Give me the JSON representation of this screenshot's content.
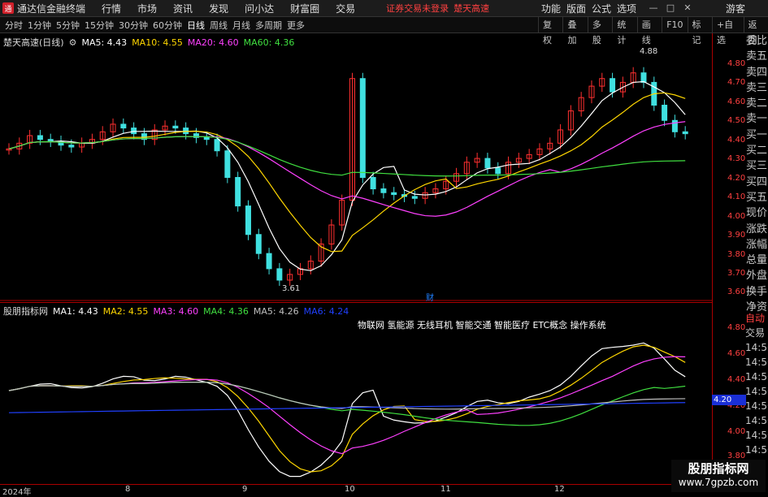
{
  "app": {
    "logo": "通",
    "name": "通达信金融终端",
    "menu": [
      "行情",
      "市场",
      "资讯",
      "发现",
      "问小达",
      "财富圈",
      "交易"
    ],
    "notice1": "证券交易未登录",
    "notice2": "楚天高速",
    "right_menu": [
      "功能",
      "版面",
      "公式",
      "选项"
    ],
    "guest": "游客",
    "win_buttons": [
      "—",
      "□",
      "✕"
    ]
  },
  "toolbar": {
    "items": [
      "分时",
      "1分钟",
      "5分钟",
      "15分钟",
      "30分钟",
      "60分钟",
      "日线",
      "周线",
      "月线",
      "多周期",
      "更多"
    ],
    "active": "日线",
    "right": [
      "复权",
      "叠加",
      "多股",
      "统计",
      "画线",
      "F10",
      "标记",
      "+自选",
      "返回"
    ]
  },
  "main": {
    "stock_label": "楚天高速(日线)",
    "ma": [
      {
        "k": "MA5: 4.43",
        "c": "#ffffff"
      },
      {
        "k": "MA10: 4.55",
        "c": "#ffd700"
      },
      {
        "k": "MA20: 4.60",
        "c": "#ff40ff"
      },
      {
        "k": "MA60: 4.36",
        "c": "#40e040"
      }
    ],
    "high": "4.88",
    "low": "3.61",
    "cai": "财"
  },
  "price_axis": [
    "4.80",
    "4.70",
    "4.60",
    "4.50",
    "4.40",
    "4.30",
    "4.20",
    "4.10",
    "4.00",
    "3.90",
    "3.80",
    "3.70",
    "3.60"
  ],
  "ind_axis": [
    "4.80",
    "4.60",
    "4.40",
    "4.20",
    "4.00",
    "3.80"
  ],
  "right_labels": [
    "委比",
    "卖五",
    "卖四",
    "卖三",
    "卖二",
    "卖一",
    "买一",
    "买二",
    "买三",
    "买四",
    "买五",
    "现价",
    "涨跌",
    "涨幅",
    "总量",
    "外盘",
    "换手",
    "净资",
    "收益"
  ],
  "indicator": {
    "label": "股朋指标网",
    "lines": [
      {
        "k": "MA1: 4.43",
        "c": "#ffffff"
      },
      {
        "k": "MA2: 4.55",
        "c": "#ffd700"
      },
      {
        "k": "MA3: 4.60",
        "c": "#ff40ff"
      },
      {
        "k": "MA4: 4.36",
        "c": "#40e040"
      },
      {
        "k": "MA5: 4.26",
        "c": "#c0c0c0"
      },
      {
        "k": "MA6: 4.24",
        "c": "#2040ff"
      }
    ],
    "notes": "物联网 氢能源 无线耳机 智能交通 智能医疗 ETC概念 操作系统",
    "badge": "4.20"
  },
  "right2": [
    "自动",
    "交易",
    "14:56",
    "14:56",
    "14:56",
    "14:56",
    "14:56",
    "14:56",
    "14:56",
    "14:56",
    "14:56"
  ],
  "xaxis": [
    "2024年",
    "8",
    "9",
    "10",
    "11",
    "12"
  ],
  "watermark": {
    "title": "股朋指标网",
    "url": "www.7gpzb.com"
  }
}
